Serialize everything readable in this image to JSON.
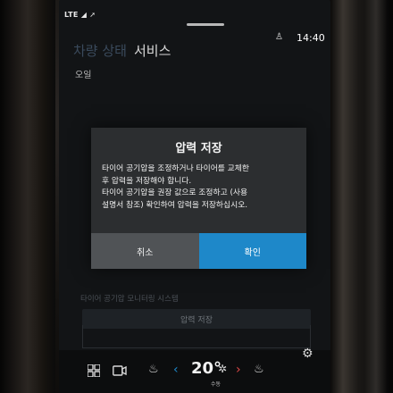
{
  "status": {
    "network": "LTE",
    "time": "14:40"
  },
  "tabs": [
    {
      "label": "차량 상태"
    },
    {
      "label": "서비스"
    }
  ],
  "sub_label": "오일",
  "background": {
    "list_text": "타이어 공기압 모니터링 시스템",
    "save_button": "압력 저장"
  },
  "dialog": {
    "title": "압력 저장",
    "lines": [
      "타이어 공기압을 조정하거나 타이어를 교체한",
      "후 압력을 저장해야 합니다.",
      "타이어 공기압을 권장 값으로 조정하고 (사용",
      "설명서 참조) 확인하여 압력을 저장하십시오."
    ],
    "cancel_label": "취소",
    "ok_label": "확인"
  },
  "climate": {
    "temperature": "20°",
    "temp_sub": "수동"
  },
  "colors": {
    "accent": "#1e88c9",
    "dialog_bg": "#2c2e30",
    "cancel_bg": "#505356"
  }
}
